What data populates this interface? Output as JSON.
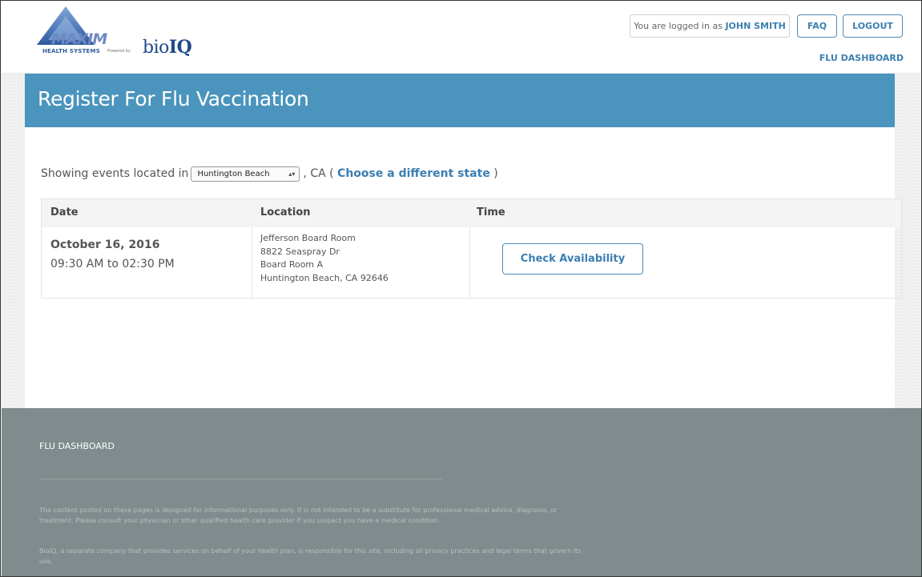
{
  "header": {
    "logo": {
      "brand": "MAXIM",
      "subtitle": "HEALTH SYSTEMS",
      "powered_by": "Powered by",
      "partner_prefix": "bio",
      "partner_suffix": "IQ"
    },
    "logged_in_prefix": "You are logged in as",
    "user_name": "JOHN SMITH",
    "faq_label": "FAQ",
    "logout_label": "LOGOUT",
    "dashboard_link": "FLU DASHBOARD"
  },
  "page": {
    "title": "Register For Flu Vaccination",
    "filter": {
      "prefix": "Showing events located in",
      "selected_city": "Huntington Beach",
      "state_suffix": ", CA (",
      "change_link": "Choose a different state",
      "close_paren": ")"
    },
    "table": {
      "columns": [
        "Date",
        "Location",
        "Time"
      ],
      "rows": [
        {
          "date": "October 16, 2016",
          "time": "09:30 AM to 02:30 PM",
          "location_lines": [
            "Jefferson Board Room",
            "8822 Seaspray Dr",
            "Board Room A",
            "Huntington Beach, CA 92646"
          ],
          "action_label": "Check Availability"
        }
      ]
    }
  },
  "footer": {
    "title": "FLU DASHBOARD",
    "disclaimer_1": "The content posted on these pages is designed for informational purposes only. It is not intended to be a substitute for professional medical advice, diagnosis, or treatment. Please consult your physician or other qualified health care provider if you suspect you have a medical condition.",
    "disclaimer_2": "BioIQ, a separate company that provides services on behalf of your health plan, is responsible for this site, including all privacy practices and legal terms that govern its use."
  },
  "colors": {
    "accent": "#3b7fb0",
    "title_bar": "#4b94bd",
    "footer_bg": "#7f8b8c"
  }
}
